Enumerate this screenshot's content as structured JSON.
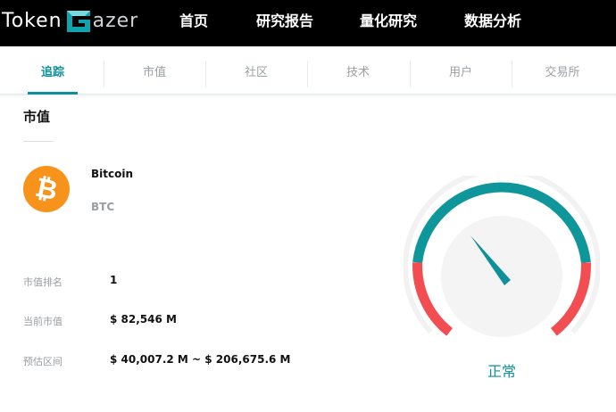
{
  "header": {
    "logo": {
      "part1": "Token",
      "part2": "azer"
    },
    "nav": [
      "首页",
      "研究报告",
      "量化研究",
      "数据分析"
    ]
  },
  "tabs": [
    "追踪",
    "市值",
    "社区",
    "技术",
    "用户",
    "交易所"
  ],
  "active_tab_index": 0,
  "section": {
    "title": "市值"
  },
  "coin": {
    "name": "Bitcoin",
    "symbol": "BTC",
    "icon": "bitcoin-icon",
    "icon_glyph": "₿",
    "icon_color": "#f7931a"
  },
  "stats": [
    {
      "label": "市值排名",
      "value": "1"
    },
    {
      "label": "当前市值",
      "value": "$ 82,546 M"
    },
    {
      "label": "预估区间",
      "value": "$ 40,007.2 M ~ $ 206,675.6 M"
    }
  ],
  "gauge": {
    "status": "正常",
    "colors": {
      "normal": "#0e969b",
      "danger": "#f24e52",
      "track": "#f2f2f2",
      "needle": "#0e8f9a"
    }
  }
}
